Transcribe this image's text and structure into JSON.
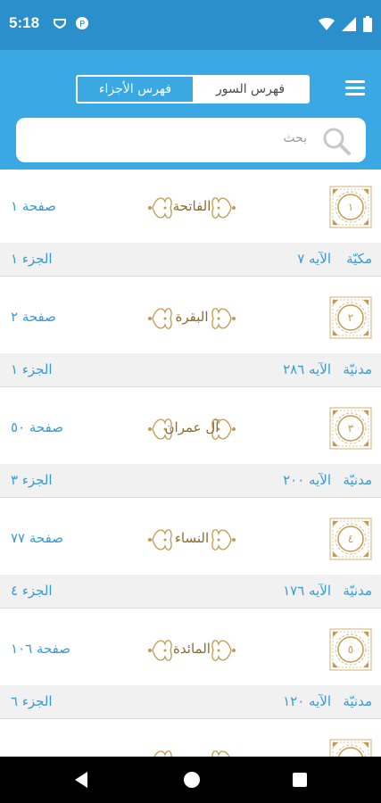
{
  "status_bar": {
    "time": "5:18",
    "left_icons": [
      "pocket-icon",
      "app-icon"
    ],
    "right_icons": [
      "wifi-icon",
      "signal-icon",
      "battery-icon"
    ]
  },
  "header": {
    "tabs": [
      {
        "label": "فهرس الأجزاء",
        "active": true
      },
      {
        "label": "فهرس السور",
        "active": false
      }
    ],
    "search_placeholder": "بحث"
  },
  "surahs": [
    {
      "number": "١",
      "name": "الفاتحة",
      "page": "صفحة ١",
      "type": "مكيّة",
      "ayahs": "الآيه ٧",
      "juz": "الجزء ١"
    },
    {
      "number": "٢",
      "name": "البقرة",
      "page": "صفحة ٢",
      "type": "مدنيّة",
      "ayahs": "الآيه ٢٨٦",
      "juz": "الجزء ١"
    },
    {
      "number": "٣",
      "name": "آل عمران",
      "page": "صفحة ٥٠",
      "type": "مدنيّة",
      "ayahs": "الآيه ٢٠٠",
      "juz": "الجزء ٣"
    },
    {
      "number": "٤",
      "name": "النساء",
      "page": "صفحة ٧٧",
      "type": "مدنيّة",
      "ayahs": "الآيه ١٧٦",
      "juz": "الجزء ٤"
    },
    {
      "number": "٥",
      "name": "المائدة",
      "page": "صفحة ١٠٦",
      "type": "مدنيّة",
      "ayahs": "الآيه ١٢٠",
      "juz": "الجزء ٦"
    },
    {
      "number": "",
      "name": "",
      "page": "",
      "type": "",
      "ayahs": "",
      "juz": ""
    }
  ],
  "colors": {
    "status_bar": "#2b8fcb",
    "header": "#3aa8e2",
    "link_text": "#3a9ad4",
    "ornament_gold": "#c49a52"
  }
}
